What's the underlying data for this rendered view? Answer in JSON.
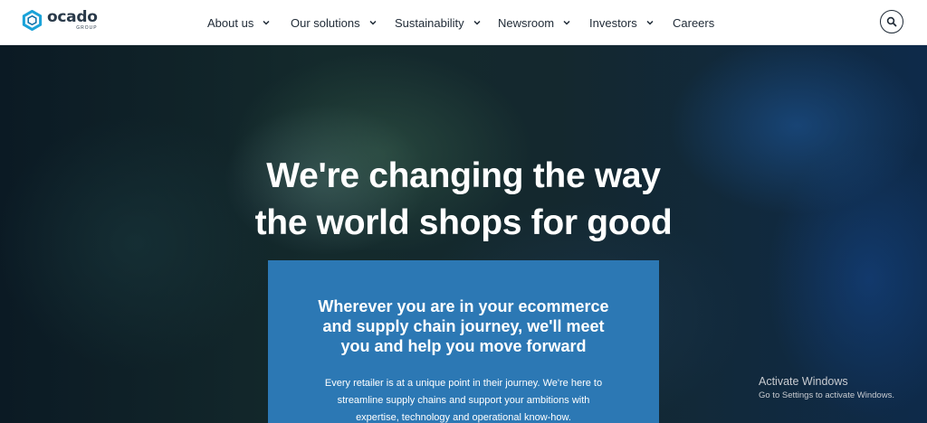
{
  "header": {
    "logo": {
      "word": "ocado",
      "sub": "GROUP",
      "icon": "hexagon-logo-icon"
    },
    "nav": [
      {
        "label": "About us",
        "has_dropdown": true
      },
      {
        "label": "Our solutions",
        "has_dropdown": true
      },
      {
        "label": "Sustainability",
        "has_dropdown": true
      },
      {
        "label": "Newsroom",
        "has_dropdown": true
      },
      {
        "label": "Investors",
        "has_dropdown": true
      },
      {
        "label": "Careers",
        "has_dropdown": false
      }
    ],
    "search_icon": "search-icon"
  },
  "hero": {
    "title_line1": "We're changing the way",
    "title_line2": "the world shops for good",
    "card": {
      "heading_line1": "Wherever you are in your ecommerce",
      "heading_line2": "and supply chain journey, we'll meet",
      "heading_line3": "you and help you move forward",
      "body_line1": "Every retailer is at a unique point in their journey. We're here to",
      "body_line2": "streamline supply chains and support your ambitions with",
      "body_line3": "expertise, technology and operational know-how."
    }
  },
  "watermark": {
    "title": "Activate Windows",
    "subtitle": "Go to Settings to activate Windows."
  },
  "colors": {
    "header_bg": "#ffffff",
    "nav_text": "#1f2a36",
    "logo_blue": "#1aa3d9",
    "card_bg": "#2c78b4",
    "hero_text": "#ffffff"
  }
}
